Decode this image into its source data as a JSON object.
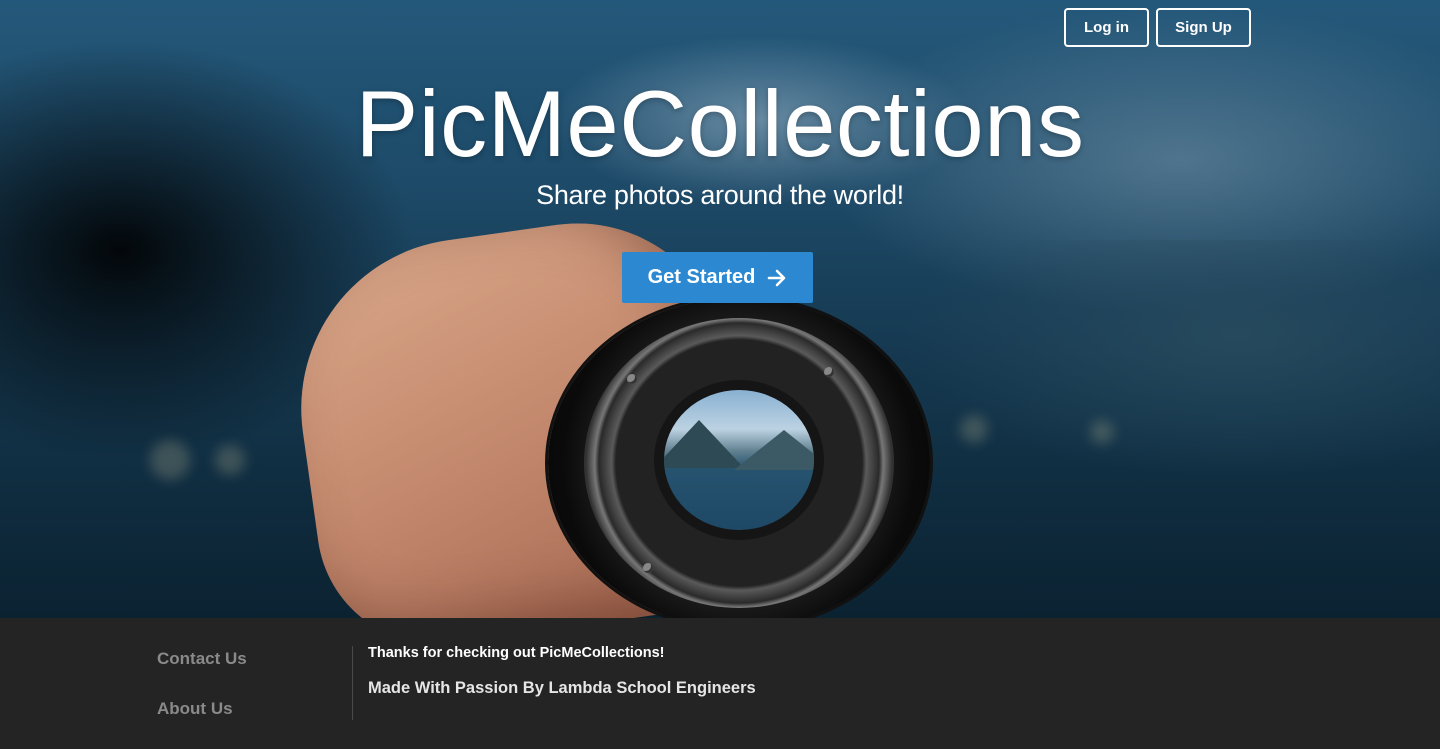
{
  "header": {
    "login_label": "Log in",
    "signup_label": "Sign Up"
  },
  "hero": {
    "title": "PicMeCollections",
    "tagline": "Share photos around the world!",
    "cta_label": "Get Started",
    "cta_icon": "arrow-right-icon",
    "background_image": "hand-holding-camera-lens-image"
  },
  "footer": {
    "links": [
      "Contact Us",
      "About Us"
    ],
    "thanks_text": "Thanks for checking out PicMeCollections!",
    "credit_text": "Made With Passion By Lambda School Engineers"
  },
  "colors": {
    "cta_blue": "#2c88d0",
    "footer_bg": "#242424",
    "footer_link": "#8a8a8a"
  }
}
